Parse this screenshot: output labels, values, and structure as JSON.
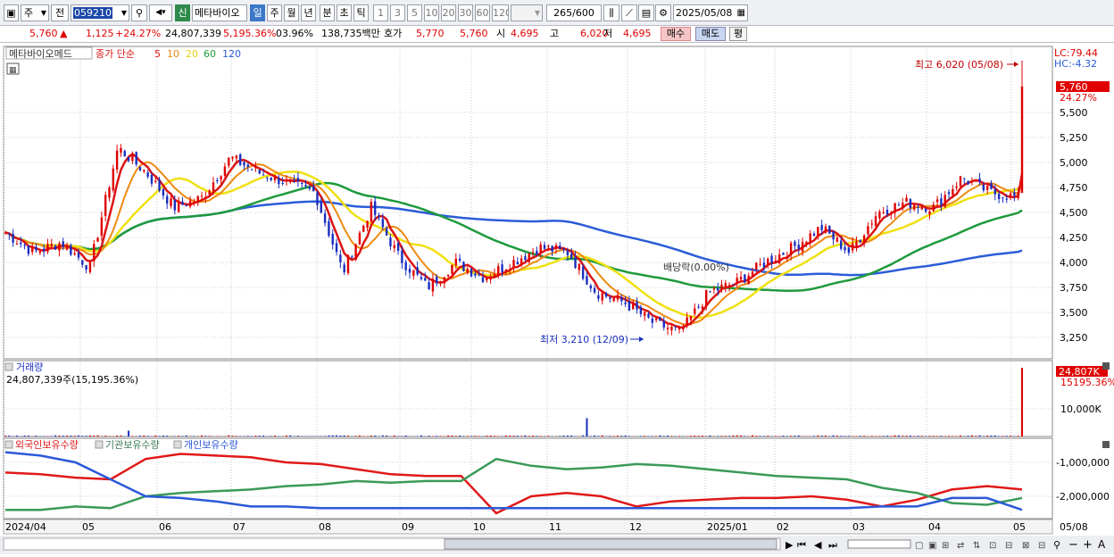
{
  "toolbar": {
    "market_type": "주",
    "market_select": "전",
    "stock_code": "059210",
    "shin_badge": "신",
    "stock_name": "메타바이오",
    "period_buttons": [
      "일",
      "주",
      "월",
      "년",
      "분",
      "초",
      "틱"
    ],
    "interval_buttons": [
      "1",
      "3",
      "5",
      "10",
      "20",
      "30",
      "60",
      "120"
    ],
    "count_display": "265/600",
    "date": "2025/05/08"
  },
  "quote": {
    "price": "5,760",
    "change_arrow": "▲",
    "change": "1,125",
    "change_pct": "+24.27%",
    "volume": "24,807,339",
    "volume_ratio": "5,195.36%",
    "turnover": "03.96%",
    "amount": "138,735백만",
    "hoga_label": "호가",
    "ask": "5,770",
    "bid": "5,760",
    "open_label": "시",
    "open": "4,695",
    "high_label": "고",
    "high": "6,020",
    "low_label": "저",
    "low": "4,695",
    "buy_button": "매수",
    "sell_button": "매도",
    "eval_button": "평"
  },
  "colors": {
    "up": "#e00000",
    "down": "#1a2ec0",
    "ma5": "#dc1414",
    "ma10": "#ee8a10",
    "ma20": "#f0e010",
    "ma60": "#1e9a3c",
    "ma120": "#2a5cd8",
    "foreign": "#e01818",
    "institution": "#3a9a58",
    "individual": "#2a58d8"
  },
  "price_panel": {
    "legend": {
      "stock": "메타바이오메드",
      "series_label": "종가 단순",
      "ma_periods": [
        "5",
        "10",
        "20",
        "60",
        "120"
      ]
    },
    "lc_label": "LC:79.44",
    "hc_label": "HC:-4.32",
    "last_price_tag": "5,760",
    "last_pct_tag": "24.27%",
    "high_annotation": "최고 6,020 (05/08)",
    "low_annotation": "최저 3,210 (12/09)",
    "dividend_annotation": "배당락(0.00%)",
    "y_ticks": [
      "5,500",
      "5,250",
      "5,000",
      "4,750",
      "4,500",
      "4,250",
      "4,000",
      "3,750",
      "3,500",
      "3,250"
    ]
  },
  "volume_panel": {
    "title": "거래량",
    "value_label": "24,807,339주(15,195.36%)",
    "last_tag": "24,807K",
    "last_pct": "15195.36%",
    "y_tick": "10,000K"
  },
  "holdings_panel": {
    "legend": [
      "외국인보유수량",
      "기관보유수량",
      "개인보유수량"
    ],
    "y_ticks": [
      "-1,000,000",
      "-2,000,000"
    ]
  },
  "x_axis": {
    "labels": [
      "2024/04",
      "05",
      "06",
      "07",
      "08",
      "09",
      "10",
      "11",
      "12",
      "2025/01",
      "02",
      "03",
      "04",
      "05"
    ],
    "current_date": "05/08"
  },
  "chart_data": {
    "type": "candlestick",
    "price_range": [
      3100,
      6100
    ],
    "high": {
      "value": 6020,
      "date": "05/08"
    },
    "low": {
      "value": 3210,
      "date": "12/09"
    },
    "last_close": 5760,
    "close_anchors": [
      {
        "date": "2024/04",
        "close": 4300
      },
      {
        "date": "04 end",
        "close": 4100
      },
      {
        "date": "05 mid",
        "close": 4200
      },
      {
        "date": "05 late",
        "close": 3950
      },
      {
        "date": "05 spike",
        "close": 5150
      },
      {
        "date": "06 early",
        "close": 4900
      },
      {
        "date": "06",
        "close": 4550
      },
      {
        "date": "06 late",
        "close": 4650
      },
      {
        "date": "07",
        "close": 5050
      },
      {
        "date": "07 mid",
        "close": 4900
      },
      {
        "date": "07 late",
        "close": 4800
      },
      {
        "date": "08",
        "close": 4700
      },
      {
        "date": "08 dip",
        "close": 3900
      },
      {
        "date": "08 mid",
        "close": 4550
      },
      {
        "date": "08 late",
        "close": 4050
      },
      {
        "date": "09",
        "close": 3750
      },
      {
        "date": "09 mid",
        "close": 4000
      },
      {
        "date": "09 late",
        "close": 3850
      },
      {
        "date": "10",
        "close": 4000
      },
      {
        "date": "10 mid",
        "close": 4150
      },
      {
        "date": "11",
        "close": 4100
      },
      {
        "date": "11 mid",
        "close": 3700
      },
      {
        "date": "11 late",
        "close": 3600
      },
      {
        "date": "12 early",
        "close": 3400
      },
      {
        "date": "12/09",
        "close": 3300
      },
      {
        "date": "12 late",
        "close": 3700
      },
      {
        "date": "2025/01",
        "close": 3800
      },
      {
        "date": "01 late",
        "close": 4000
      },
      {
        "date": "02",
        "close": 4150
      },
      {
        "date": "02 late",
        "close": 4350
      },
      {
        "date": "03",
        "close": 4100
      },
      {
        "date": "03 mid",
        "close": 4500
      },
      {
        "date": "03 late",
        "close": 4600
      },
      {
        "date": "04",
        "close": 4550
      },
      {
        "date": "04 mid",
        "close": 4850
      },
      {
        "date": "04 late",
        "close": 4700
      },
      {
        "date": "05",
        "close": 4650
      },
      {
        "date": "05/08",
        "close": 5760
      }
    ],
    "volume_unit": "K",
    "volume_range": [
      0,
      24807
    ],
    "volume_spikes": [
      {
        "date": "05 spike",
        "value": 2100
      },
      {
        "date": "10 spike",
        "value": 6600
      },
      {
        "date": "05/08",
        "value": 24807
      }
    ],
    "holdings_range": [
      -2400000,
      -400000
    ],
    "holdings_series": [
      {
        "name": "외국인보유수량",
        "values": [
          -1300000,
          -1350000,
          -1450000,
          -1500000,
          -900000,
          -750000,
          -800000,
          -850000,
          -1000000,
          -1050000,
          -1200000,
          -1350000,
          -1400000,
          -1400000,
          -2500000,
          -2000000,
          -1900000,
          -2000000,
          -2300000,
          -2150000,
          -2100000,
          -2050000,
          -2050000,
          -2000000,
          -2100000,
          -2300000,
          -2100000,
          -1800000,
          -1700000,
          -1800000
        ]
      },
      {
        "name": "기관보유수량",
        "values": [
          -2400000,
          -2400000,
          -2300000,
          -2350000,
          -2000000,
          -1900000,
          -1850000,
          -1800000,
          -1700000,
          -1650000,
          -1550000,
          -1600000,
          -1550000,
          -1550000,
          -900000,
          -1100000,
          -1200000,
          -1150000,
          -1050000,
          -1100000,
          -1200000,
          -1300000,
          -1400000,
          -1450000,
          -1500000,
          -1750000,
          -1900000,
          -2200000,
          -2250000,
          -2050000
        ]
      },
      {
        "name": "개인보유수량",
        "values": [
          -700000,
          -800000,
          -1000000,
          -1500000,
          -2000000,
          -2050000,
          -2150000,
          -2300000,
          -2300000,
          -2350000,
          -2350000,
          -2350000,
          -2350000,
          -2350000,
          -2350000,
          -2350000,
          -2350000,
          -2350000,
          -2350000,
          -2350000,
          -2350000,
          -2350000,
          -2350000,
          -2350000,
          -2350000,
          -2300000,
          -2300000,
          -2050000,
          -2050000,
          -2400000
        ]
      }
    ]
  }
}
